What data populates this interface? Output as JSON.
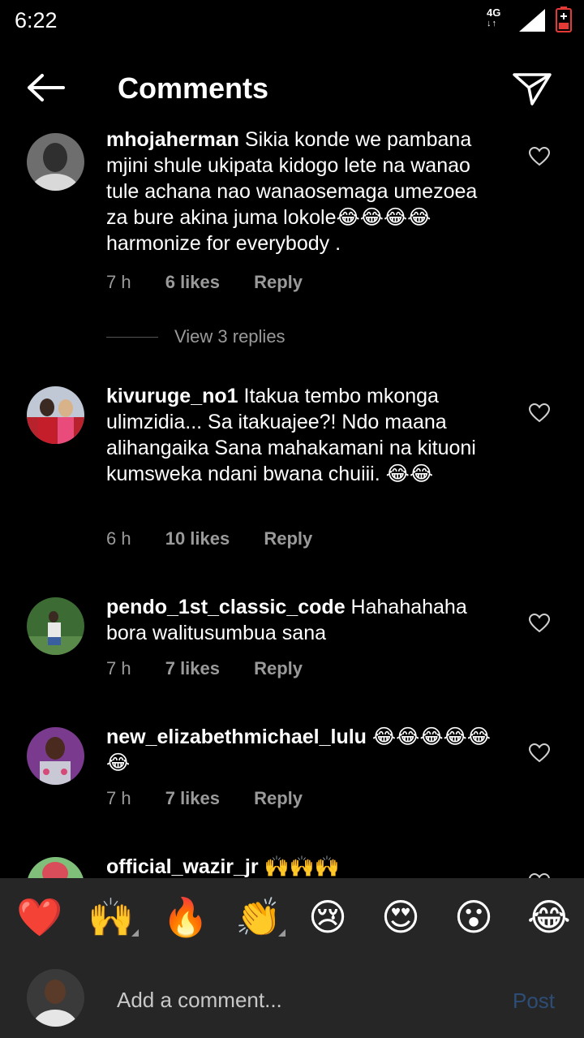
{
  "status_bar": {
    "time": "6:22",
    "network": "4G",
    "network_arrows": "↓↑"
  },
  "header": {
    "title": "Comments"
  },
  "comments": [
    {
      "username": "mhojaherman",
      "text": "Sikia konde we pambana mjini shule ukipata kidogo lete na wanao tule achana nao wanaosemaga umezoea za bure akina juma lokole😂😂😂😂harmonize for everybody .",
      "time": "7 h",
      "likes": "6 likes",
      "reply": "Reply",
      "view_replies": "View 3 replies"
    },
    {
      "username": "kivuruge_no1",
      "text": "Itakua tembo mkonga ulimzidia... Sa itakuajee?! Ndo maana alihangaika Sana mahakamani na kituoni kumsweka ndani bwana chuiii. 😂😂",
      "time": "6 h",
      "likes": "10 likes",
      "reply": "Reply"
    },
    {
      "username": "pendo_1st_classic_code",
      "text": "Hahahahaha bora walitusumbua sana",
      "time": "7 h",
      "likes": "7 likes",
      "reply": "Reply"
    },
    {
      "username": "new_elizabethmichael_lulu",
      "text": "😂😂😂😂😂😂",
      "time": "7 h",
      "likes": "7 likes",
      "reply": "Reply"
    },
    {
      "username": "official_wazir_jr",
      "text": "🙌🙌🙌"
    }
  ],
  "quick_reactions": [
    "❤️",
    "🙌",
    "🔥",
    "👏",
    "😢",
    "😍",
    "😮",
    "😂"
  ],
  "composer": {
    "placeholder": "Add a comment...",
    "post_label": "Post"
  },
  "colors": {
    "background": "#000000",
    "panel": "#262626",
    "secondary_text": "#9a9a9a",
    "post_disabled": "#2d4d76"
  }
}
